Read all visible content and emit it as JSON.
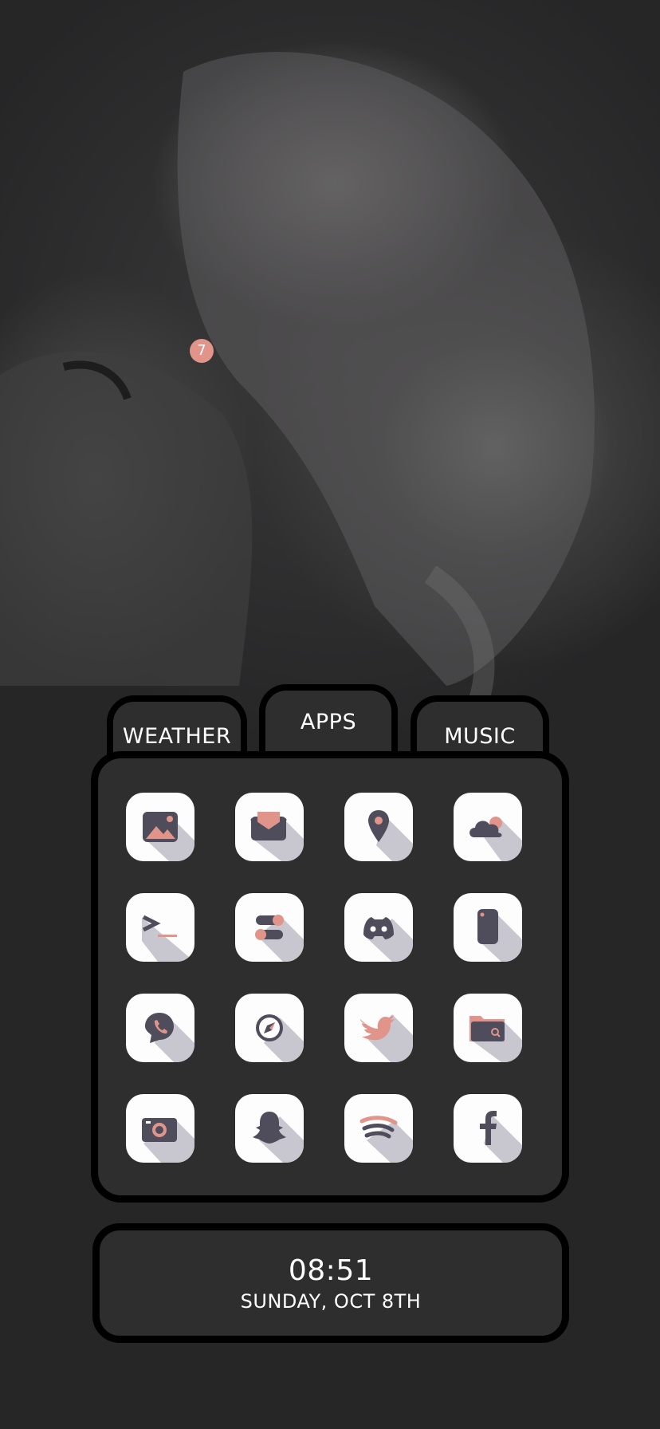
{
  "tabs": {
    "weather": "WEATHER",
    "apps": "APPS",
    "music": "MUSIC"
  },
  "apps": [
    {
      "name": "Photos",
      "icon": "photos-icon"
    },
    {
      "name": "Mail",
      "icon": "mail-icon"
    },
    {
      "name": "Maps",
      "icon": "map-pin-icon"
    },
    {
      "name": "Weather",
      "icon": "cloud-icon"
    },
    {
      "name": "Terminal",
      "icon": "terminal-icon"
    },
    {
      "name": "Settings",
      "icon": "toggle-icon"
    },
    {
      "name": "Discord",
      "icon": "discord-icon"
    },
    {
      "name": "Phone",
      "icon": "device-icon"
    },
    {
      "name": "WhatsApp",
      "icon": "call-bubble-icon"
    },
    {
      "name": "Safari",
      "icon": "compass-icon"
    },
    {
      "name": "Twitter",
      "icon": "twitter-icon"
    },
    {
      "name": "Files",
      "icon": "folder-search-icon"
    },
    {
      "name": "Camera",
      "icon": "camera-icon"
    },
    {
      "name": "Snapchat",
      "icon": "ghost-icon"
    },
    {
      "name": "Spotify",
      "icon": "spotify-icon"
    },
    {
      "name": "Facebook",
      "icon": "facebook-icon"
    }
  ],
  "camera_badge": "7",
  "clock": {
    "time": "08:51",
    "date": "SUNDAY, OCT 8TH"
  },
  "colors": {
    "icon_dark": "#4f4d5c",
    "icon_accent": "#e0948a",
    "icon_shadow": "#c8c7cf",
    "panel_bg": "#2e2e2f",
    "border": "#000000"
  }
}
